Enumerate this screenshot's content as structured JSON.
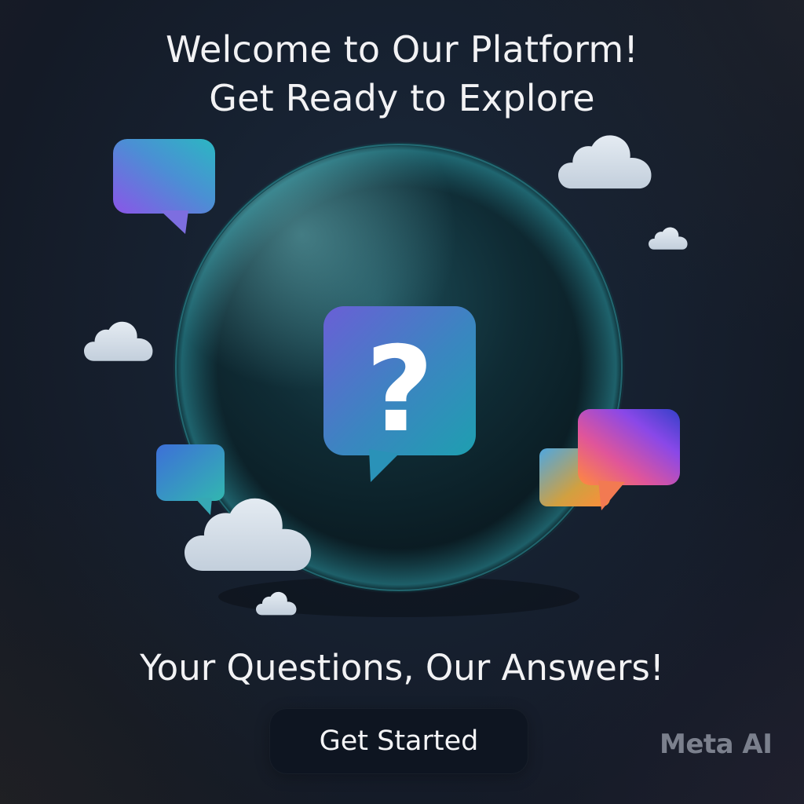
{
  "header": {
    "title_line1": "Welcome to Our Platform!",
    "title_line2": "Get Ready to Explore"
  },
  "hero": {
    "center_icon_glyph": "?",
    "icons": [
      "chat-bubble-icon",
      "question-bubble-icon",
      "cloud-icon"
    ]
  },
  "tagline": "Your Questions, Our Answers!",
  "cta": {
    "label": "Get Started"
  },
  "watermark": "Meta AI",
  "colors": {
    "background": "#16202f",
    "button": "#0e1521",
    "text": "#f2f2f4",
    "watermark": "#7b808d",
    "accent_purple": "#8a5cf0",
    "accent_teal": "#2ab8c4",
    "accent_orange": "#ff8a3c"
  }
}
